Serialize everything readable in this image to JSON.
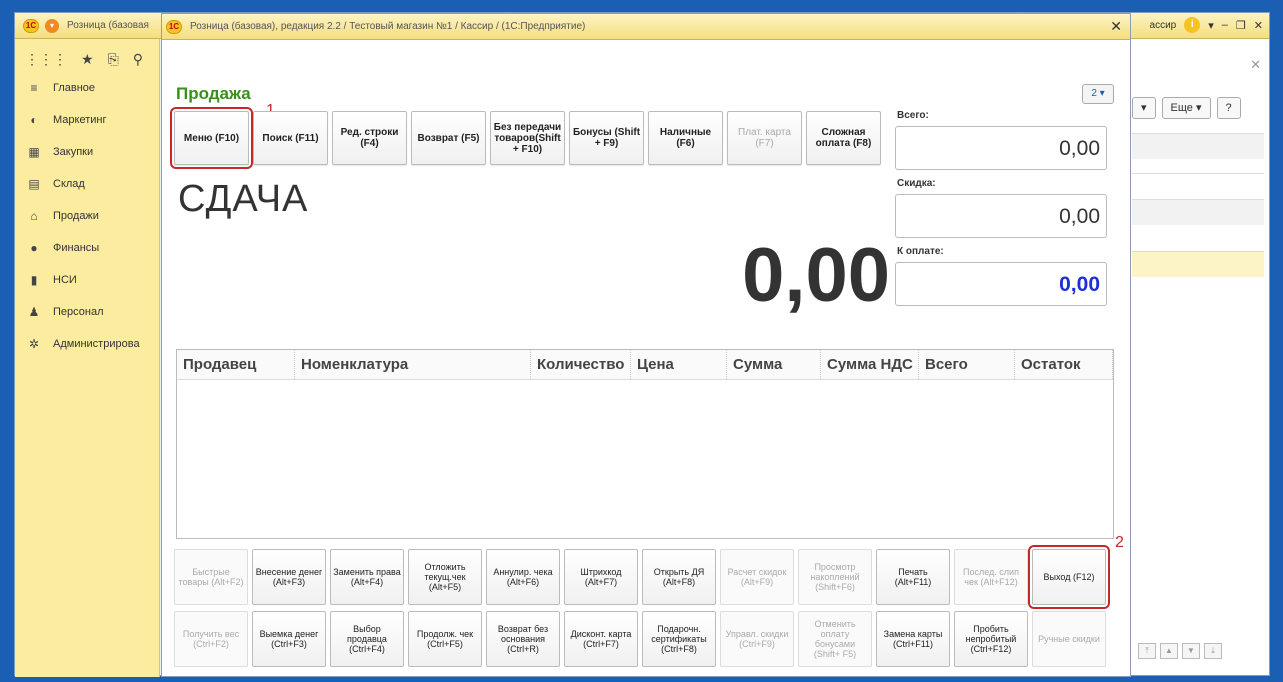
{
  "background_window": {
    "title": "Розница (базовая",
    "user": "ассир"
  },
  "sidebar": {
    "items": [
      {
        "label": "Главное",
        "icon": "menu-lines-icon"
      },
      {
        "label": "Маркетинг",
        "icon": "pie-chart-icon"
      },
      {
        "label": "Закупки",
        "icon": "cart-icon"
      },
      {
        "label": "Склад",
        "icon": "boxes-icon"
      },
      {
        "label": "Продажи",
        "icon": "basket-icon"
      },
      {
        "label": "Финансы",
        "icon": "coin-icon"
      },
      {
        "label": "НСИ",
        "icon": "books-icon"
      },
      {
        "label": "Персонал",
        "icon": "person-icon"
      },
      {
        "label": "Администрирова",
        "icon": "gear-icon"
      }
    ]
  },
  "right_panel": {
    "more_label": "Еще",
    "help_label": "?"
  },
  "modal": {
    "title": "Розница (базовая), редакция 2.2 / Тестовый магазин №1 / Кассир / (1С:Предприятие)",
    "page_title": "Продажа",
    "help_btn": "2 ▾",
    "change_label": "СДАЧА",
    "change_amount": "0,00",
    "marker_1": "1",
    "marker_2": "2",
    "toolbar": [
      {
        "label": "Меню (F10)",
        "disabled": false,
        "highlight": true
      },
      {
        "label": "Поиск (F11)",
        "disabled": false
      },
      {
        "label": "Ред. строки (F4)",
        "disabled": false
      },
      {
        "label": "Возврат (F5)",
        "disabled": false
      },
      {
        "label": "Без передачи товаров(Shift + F10)",
        "disabled": false
      },
      {
        "label": "Бонусы (Shift + F9)",
        "disabled": false
      },
      {
        "label": "Наличные (F6)",
        "disabled": false
      },
      {
        "label": "Плат. карта (F7)",
        "disabled": true
      },
      {
        "label": "Сложная оплата (F8)",
        "disabled": false
      }
    ],
    "totals": {
      "total_label": "Всего:",
      "total_value": "0,00",
      "discount_label": "Скидка:",
      "discount_value": "0,00",
      "to_pay_label": "К оплате:",
      "to_pay_value": "0,00"
    },
    "grid_columns": [
      "Продавец",
      "Номенклатура",
      "Количество",
      "Цена",
      "Сумма",
      "Сумма НДС",
      "Всего",
      "Остаток"
    ],
    "bottom_row1": [
      {
        "label": "Быстрые товары (Alt+F2)",
        "disabled": true
      },
      {
        "label": "Внесение денег (Alt+F3)",
        "disabled": false
      },
      {
        "label": "Заменить права (Alt+F4)",
        "disabled": false
      },
      {
        "label": "Отложить текущ.чек (Alt+F5)",
        "disabled": false
      },
      {
        "label": "Аннулир. чека (Alt+F6)",
        "disabled": false
      },
      {
        "label": "Штрихкод (Alt+F7)",
        "disabled": false
      },
      {
        "label": "Открыть ДЯ (Alt+F8)",
        "disabled": false
      },
      {
        "label": "Расчет скидок (Alt+F9)",
        "disabled": true
      },
      {
        "label": "Просмотр накоплений (Shift+F6)",
        "disabled": true
      },
      {
        "label": "Печать (Alt+F11)",
        "disabled": false
      },
      {
        "label": "Послед. слип чек (Alt+F12)",
        "disabled": true
      },
      {
        "label": "Выход (F12)",
        "disabled": false,
        "exit": true
      }
    ],
    "bottom_row2": [
      {
        "label": "Получить вес (Ctrl+F2)",
        "disabled": true
      },
      {
        "label": "Выемка денег (Ctrl+F3)",
        "disabled": false
      },
      {
        "label": "Выбор продавца (Ctrl+F4)",
        "disabled": false
      },
      {
        "label": "Продолж. чек (Ctrl+F5)",
        "disabled": false
      },
      {
        "label": "Возврат без основания (Ctrl+R)",
        "disabled": false
      },
      {
        "label": "Дисконт. карта (Ctrl+F7)",
        "disabled": false
      },
      {
        "label": "Подарочн. сертификаты (Ctrl+F8)",
        "disabled": false
      },
      {
        "label": "Управл. скидки (Ctrl+F9)",
        "disabled": true
      },
      {
        "label": "Отменить оплату бонусами (Shift+ F5)",
        "disabled": true
      },
      {
        "label": "Замена карты (Ctrl+F11)",
        "disabled": false
      },
      {
        "label": "Пробить непробитый (Ctrl+F12)",
        "disabled": false
      },
      {
        "label": "Ручные скидки",
        "disabled": true
      }
    ]
  }
}
